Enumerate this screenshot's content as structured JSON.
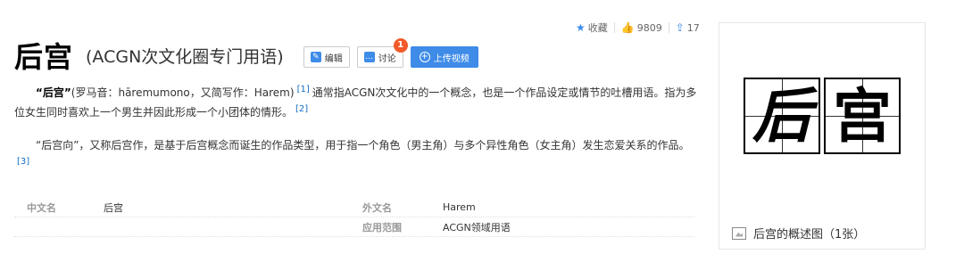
{
  "stats": {
    "favorite_label": "收藏",
    "like_count": "9809",
    "share_count": "17"
  },
  "header": {
    "title": "后宫",
    "subtitle": "(ACGN次文化圈专门用语)",
    "edit_label": "编辑",
    "discuss_label": "讨论",
    "discuss_badge": "1",
    "upload_label": "上传视频"
  },
  "summary": {
    "p1_term": "“后宫”",
    "p1_text_a": "(罗马音：hāremumono，又简写作：Harem)",
    "p1_ref1": "[1]",
    "p1_text_b": "通常指ACGN次文化中的一个概念，也是一个作品设定或情节的吐槽用语。指为多位女生同时喜欢上一个男生并因此形成一个小团体的情形。",
    "p1_ref2": "[2]",
    "p2_text": "“后宫向”，又称后宫作，是基于后宫概念而诞生的作品类型，用于指一个角色（男主角）与多个异性角色（女主角）发生恋爱关系的作品。",
    "p2_ref3": "[3]"
  },
  "info": {
    "row1": {
      "l1": "中文名",
      "v1": "后宫",
      "l2": "外文名",
      "v2": "Harem"
    },
    "row2": {
      "l2": "应用范围",
      "v2": "ACGN领域用语"
    }
  },
  "picture": {
    "glyph1": "后",
    "glyph2": "宫",
    "caption": "后宫的概述图（1张）"
  },
  "colors": {
    "accent": "#3e8be8",
    "badge": "#f25a29",
    "link": "#136ec2"
  }
}
